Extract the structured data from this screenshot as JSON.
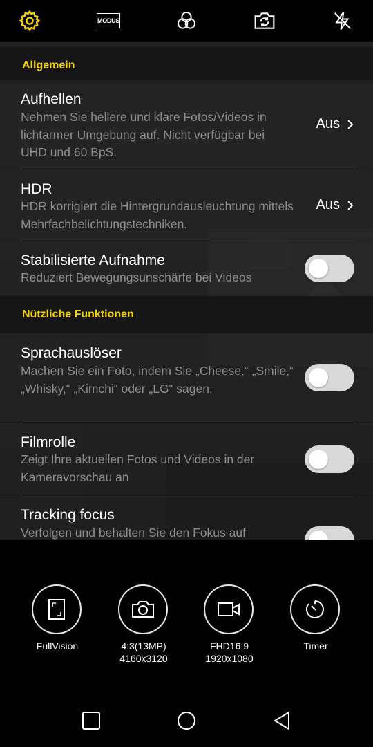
{
  "top_toolbar": {
    "icons": [
      "settings-gear-icon",
      "mode-icon",
      "filters-icon",
      "switch-camera-icon",
      "flash-off-icon"
    ],
    "mode_label": "MODUS"
  },
  "settings": {
    "sections": [
      {
        "title": "Allgemein",
        "items": [
          {
            "title": "Aufhellen",
            "desc": "Nehmen Sie hellere und klare Fotos/Videos in lichtarmer Umgebung auf. Nicht verfügbar bei UHD und 60 BpS.",
            "value": "Aus"
          },
          {
            "title": "HDR",
            "desc": "HDR korrigiert die Hintergrundausleuchtung mittels Mehrfachbelichtungstechniken.",
            "value": "Aus"
          },
          {
            "title": "Stabilisierte Aufnahme",
            "desc": "Reduziert Bewegungsunschärfe bei Videos",
            "toggle": false
          }
        ]
      },
      {
        "title": "Nützliche Funktionen",
        "items": [
          {
            "title": "Sprachauslöser",
            "desc": "Machen Sie ein Foto, indem Sie „Cheese,“ „Smile,“ „Whisky,“ „Kimchi“ oder „LG“ sagen.",
            "toggle": false
          },
          {
            "title": "Filmrolle",
            "desc": "Zeigt Ihre aktuellen Fotos und Videos in der Kameravorschau an",
            "toggle": false
          },
          {
            "title": "Tracking focus",
            "desc": "Verfolgen und behalten Sie den Fokus auf",
            "toggle": false
          }
        ]
      }
    ]
  },
  "quick_modes": [
    {
      "icon": "fullvision-icon",
      "line1": "FullVision",
      "line2": ""
    },
    {
      "icon": "camera-icon",
      "line1": "4:3(13MP)",
      "line2": "4160x3120"
    },
    {
      "icon": "video-camera-icon",
      "line1": "FHD16:9",
      "line2": "1920x1080"
    },
    {
      "icon": "timer-icon",
      "line1": "Timer",
      "line2": ""
    }
  ],
  "nav_bar": {
    "icons": [
      "recents-square-icon",
      "home-circle-icon",
      "back-triangle-icon"
    ]
  }
}
